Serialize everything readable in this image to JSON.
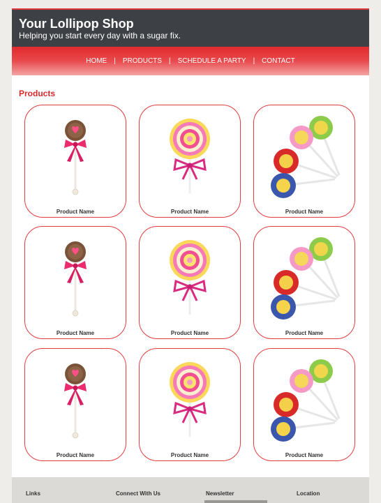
{
  "header": {
    "title": "Your Lollipop Shop",
    "tagline": "Helping you start every day with a sugar fix."
  },
  "nav": {
    "items": [
      {
        "label": "HOME"
      },
      {
        "label": "PRODUCTS"
      },
      {
        "label": "SCHEDULE A PARTY"
      },
      {
        "label": "CONTACT"
      }
    ],
    "separator": "|"
  },
  "main": {
    "section_title": "Products",
    "products": [
      {
        "label": "Product Name",
        "image": "heart-lollipop-icon"
      },
      {
        "label": "Product Name",
        "image": "swirl-lollipop-icon"
      },
      {
        "label": "Product Name",
        "image": "chupa-chups-lollipops-icon"
      },
      {
        "label": "Product Name",
        "image": "heart-lollipop-icon"
      },
      {
        "label": "Product Name",
        "image": "swirl-lollipop-icon"
      },
      {
        "label": "Product Name",
        "image": "chupa-chups-lollipops-icon"
      },
      {
        "label": "Product Name",
        "image": "heart-lollipop-icon"
      },
      {
        "label": "Product Name",
        "image": "swirl-lollipop-icon"
      },
      {
        "label": "Product Name",
        "image": "chupa-chups-lollipops-icon"
      }
    ]
  },
  "footer": {
    "links": "Links",
    "connect": "Connect With Us",
    "newsletter": "Newsletter",
    "location": "Location"
  },
  "colors": {
    "accent": "#e23a3d",
    "header_bg": "#3d4044",
    "page_bg": "#eeede9"
  }
}
